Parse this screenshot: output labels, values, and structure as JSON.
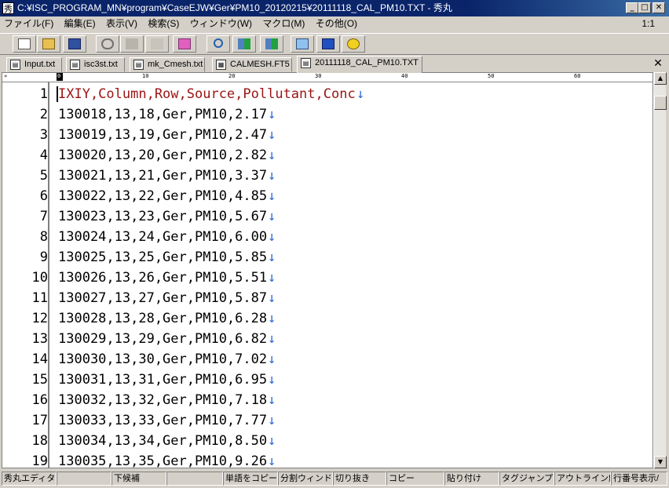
{
  "window": {
    "title": "C:¥ISC_PROGRAM_MN¥program¥CaseEJW¥Ger¥PM10_20120215¥20111118_CAL_PM10.TXT - 秀丸",
    "app_icon": "秀",
    "minimize": "_",
    "maximize": "□",
    "close": "✕"
  },
  "menu": {
    "items": [
      "ファイル(F)",
      "編集(E)",
      "表示(V)",
      "検索(S)",
      "ウィンドウ(W)",
      "マクロ(M)",
      "その他(O)"
    ],
    "zoom": "1:1"
  },
  "toolbar": {
    "buttons": [
      "new-file-icon",
      "open-folder-icon",
      "save-icon",
      "undo-icon",
      "copy-icon",
      "cut-icon",
      "paste-icon",
      "search-icon",
      "search-down-icon",
      "search-up-icon",
      "tag-jump-icon",
      "split-window-icon",
      "help-icon"
    ]
  },
  "tabs": [
    {
      "label": "Input.txt",
      "active": false
    },
    {
      "label": "isc3st.txt",
      "active": false
    },
    {
      "label": "mk_Cmesh.txt",
      "active": false
    },
    {
      "label": "CALMESH.FT5",
      "active": false
    },
    {
      "label": "20111118_CAL_PM10.TXT",
      "active": true
    }
  ],
  "close_tab": "✕",
  "ruler": {
    "marks": [
      "0",
      "10",
      "20",
      "30",
      "40",
      "50",
      "60"
    ],
    "left_mark": "»"
  },
  "lines": [
    {
      "n": "1",
      "text": "IXIY,Column,Row,Source,Pollutant,Conc",
      "header": true
    },
    {
      "n": "2",
      "text": "130018,13,18,Ger,PM10,2.17"
    },
    {
      "n": "3",
      "text": "130019,13,19,Ger,PM10,2.47"
    },
    {
      "n": "4",
      "text": "130020,13,20,Ger,PM10,2.82"
    },
    {
      "n": "5",
      "text": "130021,13,21,Ger,PM10,3.37"
    },
    {
      "n": "6",
      "text": "130022,13,22,Ger,PM10,4.85"
    },
    {
      "n": "7",
      "text": "130023,13,23,Ger,PM10,5.67"
    },
    {
      "n": "8",
      "text": "130024,13,24,Ger,PM10,6.00"
    },
    {
      "n": "9",
      "text": "130025,13,25,Ger,PM10,5.85"
    },
    {
      "n": "10",
      "text": "130026,13,26,Ger,PM10,5.51"
    },
    {
      "n": "11",
      "text": "130027,13,27,Ger,PM10,5.87"
    },
    {
      "n": "12",
      "text": "130028,13,28,Ger,PM10,6.28"
    },
    {
      "n": "13",
      "text": "130029,13,29,Ger,PM10,6.82"
    },
    {
      "n": "14",
      "text": "130030,13,30,Ger,PM10,7.02"
    },
    {
      "n": "15",
      "text": "130031,13,31,Ger,PM10,6.95"
    },
    {
      "n": "16",
      "text": "130032,13,32,Ger,PM10,7.18"
    },
    {
      "n": "17",
      "text": "130033,13,33,Ger,PM10,7.77"
    },
    {
      "n": "18",
      "text": "130034,13,34,Ger,PM10,8.50"
    },
    {
      "n": "19",
      "text": "130035,13,35,Ger,PM10,9.26"
    }
  ],
  "statusbar": [
    "秀丸エディタヘル",
    "",
    "下候補",
    "",
    "単語をコピー",
    "分割ウィンドウ切",
    "切り抜き",
    "コピー",
    "貼り付け",
    "タグジャンプ",
    "アウトライン解析",
    "行番号表示/"
  ],
  "colors": {
    "header_text": "#9a1414",
    "eol_arrow": "#2e6ad6",
    "title_bg": "#0a246a"
  }
}
